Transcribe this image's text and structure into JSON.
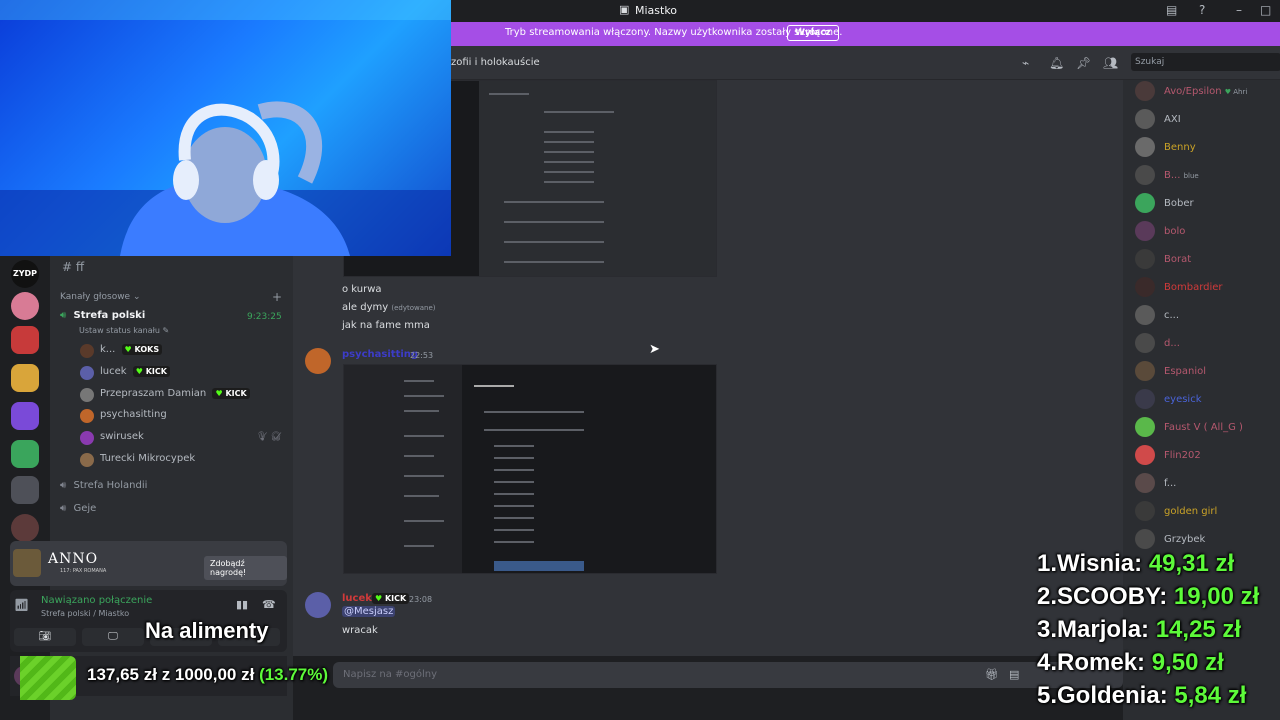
{
  "window": {
    "title": "Miastko",
    "banner_text": "Tryb streamowania włączony. Nazwy użytkownika zostały skrócone.",
    "banner_button": "Wyłącz"
  },
  "channel_header": {
    "name": "zofii i holokauście",
    "search_placeholder": "Szukaj"
  },
  "sidebar": {
    "current_channel": "ff",
    "voice_category": "Kanały głosowe",
    "channels": [
      {
        "name": "Strefa polski",
        "time": "9:23:25",
        "status": "Ustaw status kanału"
      },
      {
        "name": "Strefa Holandii"
      },
      {
        "name": "Geje"
      }
    ],
    "voice_users": [
      {
        "name": "k...",
        "badge": "KOKS"
      },
      {
        "name": "lucek",
        "badge": "KICK"
      },
      {
        "name": "Przepraszam Damian",
        "badge": "KICK"
      },
      {
        "name": "psychasitting"
      },
      {
        "name": "swirusek"
      },
      {
        "name": "Turecki Mikrocypek"
      }
    ]
  },
  "ad": {
    "brand": "ANNO",
    "subtitle": "117: PAX ROMANA",
    "button": "Zdobądź nagrodę!"
  },
  "voice_panel": {
    "status": "Nawiązano połączenie",
    "location": "Strefa polski / Miastko"
  },
  "chat": {
    "messages": [
      {
        "text": "o kurwa"
      },
      {
        "text": "ale dymy",
        "edited": "(edytowane)"
      },
      {
        "text": "jak na fame mma"
      }
    ],
    "msg2": {
      "author": "psychasitting",
      "time": "22:53"
    },
    "msg3": {
      "author": "lucek",
      "badge": "KICK",
      "time": "23:08",
      "mention": "@Mesjasz",
      "text": "wracak"
    },
    "composer_placeholder": "Napisz na #ogólny"
  },
  "members": [
    {
      "name": "Avo/Epsilon",
      "tag": "Ahri",
      "color": "#b5586e"
    },
    {
      "name": "AXI",
      "color": "#b5bac1"
    },
    {
      "name": "Benny",
      "color": "#c9a227"
    },
    {
      "name": "B...",
      "tag": "blue",
      "color": "#b5586e"
    },
    {
      "name": "Bober",
      "color": "#b5bac1"
    },
    {
      "name": "bolo",
      "color": "#b5586e"
    },
    {
      "name": "Borat",
      "color": "#b5586e"
    },
    {
      "name": "Bombardier",
      "color": "#d03a3a"
    },
    {
      "name": "c...",
      "color": "#b5bac1"
    },
    {
      "name": "d...",
      "color": "#b5586e"
    },
    {
      "name": "Espaniol",
      "color": "#b5586e"
    },
    {
      "name": "eyesick",
      "color": "#4a63d8"
    },
    {
      "name": "Faust V ( All_G )",
      "color": "#b5586e"
    },
    {
      "name": "Flin202",
      "color": "#b5586e"
    },
    {
      "name": "f...",
      "color": "#b5bac1"
    },
    {
      "name": "golden girl",
      "color": "#c9a227"
    },
    {
      "name": "Grzybek",
      "color": "#b5bac1"
    }
  ],
  "overlay": {
    "caption": "Na alimenty",
    "donation": {
      "current": "137,65 zł",
      "connector": "z",
      "goal": "1000,00 zł",
      "percent_label": "(13.77%)",
      "fraction": 0.1377
    },
    "leaderboard": [
      {
        "rank": "1.",
        "name": "Wisnia:",
        "amount": "49,31 zł"
      },
      {
        "rank": "2.",
        "name": "SCOOBY:",
        "amount": "19,00 zł"
      },
      {
        "rank": "3.",
        "name": "Marjola:",
        "amount": "14,25 zł"
      },
      {
        "rank": "4.",
        "name": "Romek:",
        "amount": "9,50 zł"
      },
      {
        "rank": "5.",
        "name": "Goldenia:",
        "amount": "5,84 zł"
      }
    ]
  },
  "colors": {
    "banner": "#a54ee6",
    "kick_green": "#53fc18",
    "overlay_green": "#5dfa3a"
  }
}
